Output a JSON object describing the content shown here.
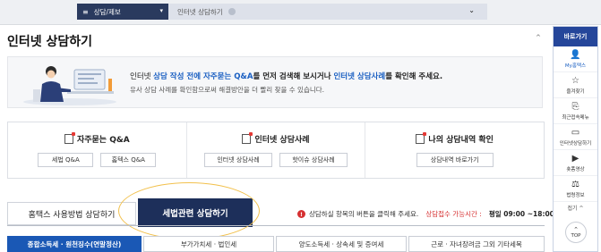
{
  "nav": {
    "menu_label": "상담/제보",
    "sub_label": "인터넷 상담하기"
  },
  "page": {
    "title": "인터넷 상담하기",
    "collapse_symbol": "^"
  },
  "banner": {
    "line1_pre": "인터넷 ",
    "line1_hl1": "상담 작성 전에 자주묻는 Q&A",
    "line1_mid": "를 먼저 검색해 보시거나 ",
    "line1_hl2": "인터넷 상담사례",
    "line1_post": "를 확인해 주세요.",
    "line2": "유사 상담 사례를 확인함으로써 해결방안을 더 빨리 찾을 수 있습니다."
  },
  "quick": {
    "faq": {
      "title": "자주묻는 Q&A",
      "btn1": "세법 Q&A",
      "btn2": "홈텍스 Q&A"
    },
    "cases": {
      "title": "인터넷 상담사례",
      "btn1": "인터넷 상담사례",
      "btn2": "핫이슈 상담사례"
    },
    "mine": {
      "title": "나의 상담내역 확인",
      "btn1": "상담내역 바로가기"
    }
  },
  "tabs": {
    "tab1": "홈택스 사용방법 상담하기",
    "tab2": "세법관련 상담하기"
  },
  "notice": {
    "warn_symbol": "!",
    "text": "상담하실 항목의 버튼을 클릭해 주세요.",
    "hours_label": "상담접수 가능시간 : ",
    "hours_value": "평일 09:00 ~18:00"
  },
  "categories": [
    "종합소득세 · 원천징수(연말정산)",
    "부가가치세 · 법인세",
    "양도소득세 · 상속세 및 증여세",
    "근로 · 자녀장려금 그외 기타세목"
  ],
  "sidebar": {
    "header": "바로가기",
    "items": [
      {
        "label": "My홈택스",
        "icon": "person-icon"
      },
      {
        "label": "즐겨찾기",
        "icon": "star-icon"
      },
      {
        "label": "최근접속메뉴",
        "icon": "history-icon"
      },
      {
        "label": "인터넷상담하기",
        "icon": "monitor-icon"
      },
      {
        "label": "숏폼영상",
        "icon": "play-icon"
      },
      {
        "label": "법령정보",
        "icon": "law-icon"
      }
    ],
    "fold_label": "접기 ^",
    "top_label": "TOP"
  },
  "colors": {
    "nav_dark": "#2a3a5e",
    "tab_active": "#1d2f5a",
    "category_active": "#1a58b5",
    "highlight": "#1a5fc2",
    "highlight_ellipse": "#f2c14e",
    "sidebar_head": "#25469a"
  }
}
